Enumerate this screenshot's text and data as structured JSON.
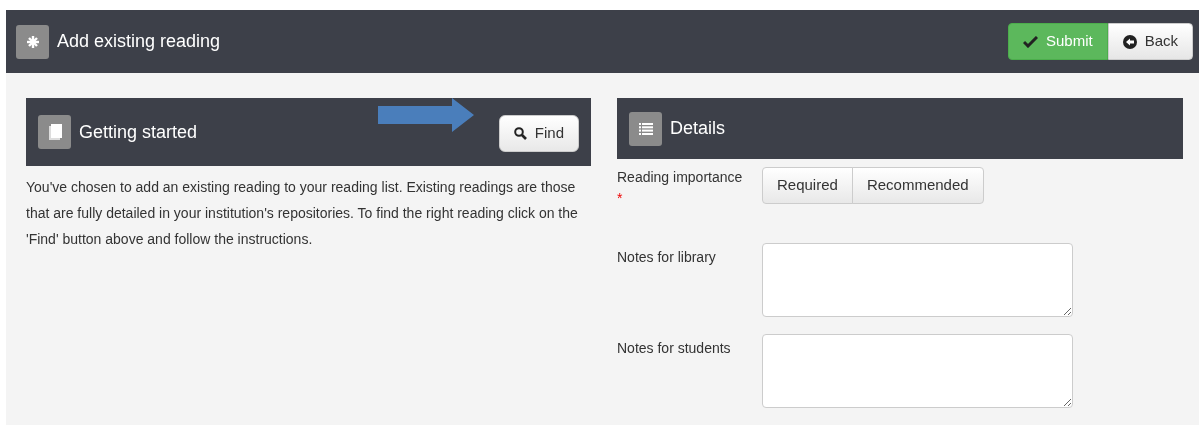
{
  "header": {
    "title": "Add existing reading",
    "buttons": [
      {
        "kind": "submit",
        "label": "Submit"
      },
      {
        "kind": "back",
        "label": "Back"
      }
    ]
  },
  "getting_started": {
    "title": "Getting started",
    "find_button": "Find",
    "text": "You've chosen to add an existing reading to your reading list. Existing readings are those that are fully detailed in your institution's repositories. To find the right reading click on the 'Find' button above and follow the instructions."
  },
  "details": {
    "title": "Details",
    "importance": {
      "label": "Reading importance",
      "required_mark": "*",
      "options": [
        {
          "label": "Required",
          "selected": false
        },
        {
          "label": "Recommended",
          "selected": false
        }
      ]
    },
    "fields": [
      {
        "label": "Notes for library"
      },
      {
        "label": "Notes for students"
      }
    ]
  }
}
